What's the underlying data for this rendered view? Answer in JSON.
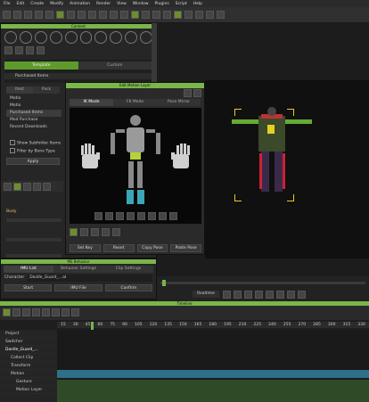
{
  "menu": [
    "File",
    "Edit",
    "Create",
    "Modify",
    "Animation",
    "Render",
    "View",
    "Window",
    "Plugins",
    "Script",
    "Help"
  ],
  "content": {
    "title": "Content",
    "tabs": [
      "Template",
      "Custom"
    ],
    "folder": "Purchased Items",
    "subtabs": [
      "Itest",
      "Pack"
    ],
    "tree": [
      "Motio",
      "Motio",
      "Purchased Items",
      "Mod Purchase",
      "Recent Downloads"
    ],
    "checks": [
      "Show Subfolder Items",
      "Filter by Bone Type"
    ],
    "apply": "Apply",
    "side_label": "Body"
  },
  "puppet": {
    "title": "Edit Motion Layer",
    "tabs": [
      "IK Mode",
      "FK Mode",
      "Pose Mirror"
    ],
    "buttons": [
      "Set Key",
      "Reset",
      "Copy Pose",
      "Paste Pose"
    ]
  },
  "mo": {
    "title": "MS Behavior",
    "tabs": [
      "IMU List",
      "Behavior Settings",
      "Clip Settings"
    ],
    "character_label": "Character",
    "character_value": "Dastle_Guard_...al",
    "row": [
      "Start",
      "IMU File",
      "Confirm"
    ]
  },
  "playbar": {
    "mode": "Realtime"
  },
  "timeline": {
    "title": "Timeline",
    "ruler": [
      "15",
      "30",
      "45",
      "60",
      "75",
      "90",
      "105",
      "120",
      "135",
      "150",
      "165",
      "180",
      "195",
      "210",
      "225",
      "240",
      "255",
      "270",
      "285",
      "300",
      "315",
      "330"
    ],
    "rows": [
      "Project",
      "Switcher",
      "Dastle_Guard_...",
      "Collect Clip",
      "Transform",
      "Motion",
      "Gesture",
      "Motion Layer"
    ]
  },
  "colors": {
    "accent": "#7ab648",
    "dark": "#1c1c1c",
    "track": "#2f4a27",
    "blue": "#2f6f8a"
  }
}
